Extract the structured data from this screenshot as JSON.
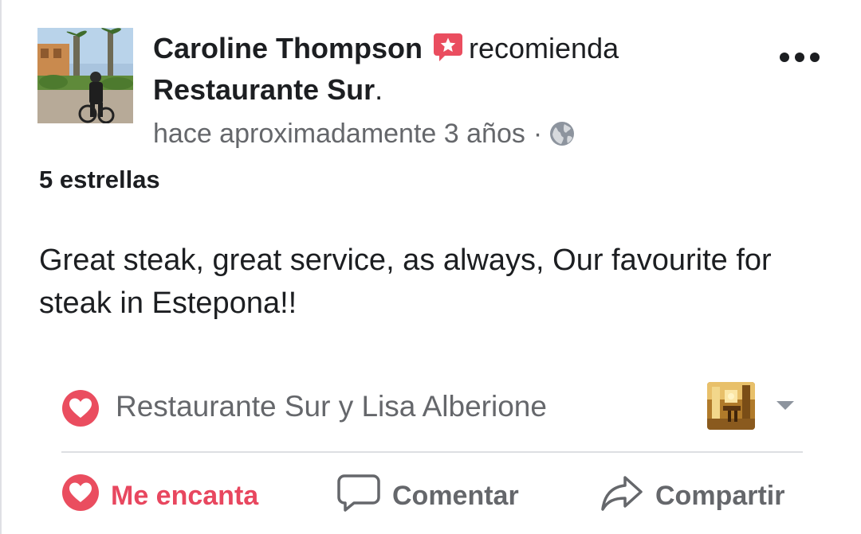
{
  "post": {
    "author": "Caroline Thompson",
    "verb": "recomienda",
    "page_name": "Restaurante Sur",
    "page_name_suffix": ".",
    "timestamp": "hace aproximadamente 3 años",
    "separator": "·",
    "audience_icon": "globe-icon",
    "recommend_icon": "recommend-star-badge-icon",
    "more_icon": "more-dots-icon"
  },
  "review": {
    "rating": "5 estrellas",
    "text": "Great steak, great service, as always, Our favourite for steak in Estepona!!"
  },
  "reactions": {
    "icon": "heart-reaction-icon",
    "names": "Restaurante Sur y Lisa Alberione",
    "thumbnail": "restaurant-interior-thumbnail",
    "dropdown_icon": "caret-down-icon"
  },
  "actions": {
    "love_label": "Me encanta",
    "comment_label": "Comentar",
    "share_label": "Compartir"
  },
  "colors": {
    "love_red": "#e8475f",
    "secondary_text": "#65676b",
    "primary_text": "#1c1e21",
    "divider": "#dddfe2"
  }
}
